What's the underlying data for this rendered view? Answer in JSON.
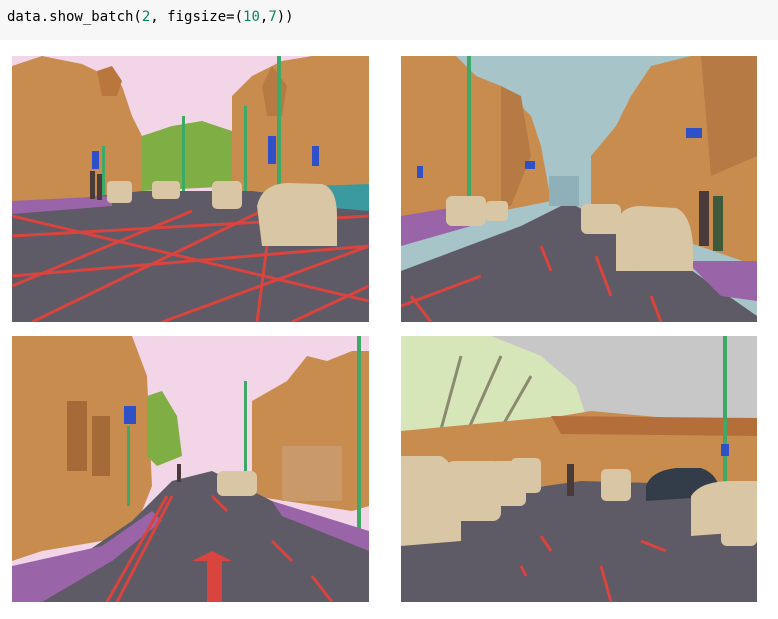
{
  "code_cell": {
    "prefix": "data.show_batch(",
    "arg1": "2",
    "mid": ", figsize=(",
    "arg2": "10",
    "comma": ",",
    "arg3": "7",
    "suffix": "))"
  },
  "colors": {
    "building": "#c98c4f",
    "sky": "#f2d6e8",
    "road": "#5e5a66",
    "sidewalk": "#9a64a8",
    "car": "#d8c6a4",
    "tree": "#7fae45",
    "pole": "#3ea866",
    "road_marking": "#d9443e",
    "pedestrian": "#4a3a3a",
    "signal": "#3050c8",
    "code_number": "#098658"
  },
  "panels": [
    {
      "scene": "street-intersection-with-yellow-box-markings"
    },
    {
      "scene": "narrow-street-lined-with-buildings"
    },
    {
      "scene": "curving-road-with-turn-arrow"
    },
    {
      "scene": "car-park-with-trees-and-shop"
    }
  ]
}
